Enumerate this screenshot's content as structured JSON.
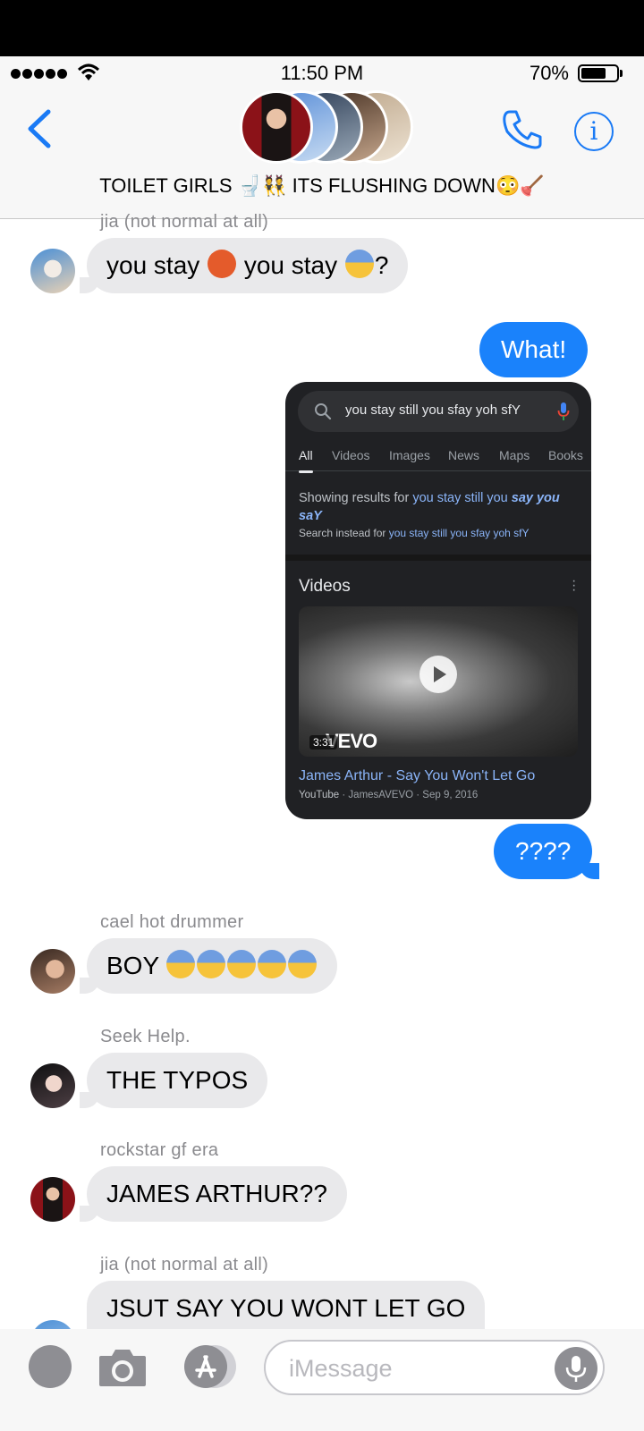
{
  "status": {
    "time": "11:50 PM",
    "battery": "70%",
    "battery_level": 0.7
  },
  "header": {
    "title": "TOILET GIRLS 🚽👯 ITS FLUSHING DOWN😳🪠",
    "back": "back-chevron-icon",
    "call": "phone-icon",
    "info_glyph": "i"
  },
  "messages": [
    {
      "sender": "jia (not normal at all)",
      "text_a": "you stay ",
      "text_b": " you stay ",
      "text_c": "?"
    },
    {
      "text": "What!"
    },
    {
      "text": "????"
    },
    {
      "sender": "cael hot drummer",
      "text": "BOY "
    },
    {
      "sender": "Seek Help.",
      "text": "THE TYPOS"
    },
    {
      "sender": "rockstar gf era",
      "text": "JAMES ARTHUR??"
    },
    {
      "sender": "jia (not normal at all)",
      "text": "JSUT SAY YOU WONT LET GO"
    }
  ],
  "screenshot": {
    "query": "you stay still you sfay yoh sfY",
    "tabs": [
      "All",
      "Videos",
      "Images",
      "News",
      "Maps",
      "Books"
    ],
    "showing_prefix": "Showing results for ",
    "showing_plain": "you stay still you ",
    "showing_bold": "say you saY",
    "instead_prefix": "Search instead for ",
    "instead_link": "you stay still you sfay yoh sfY",
    "videos_heading": "Videos",
    "duration": "3:31",
    "vevo": "VEVO",
    "video_title": "James Arthur - Say You Won't Let Go",
    "video_source": "YouTube",
    "video_meta": " · JamesAVEVO · Sep 9, 2016"
  },
  "composer": {
    "placeholder": "iMessage"
  }
}
